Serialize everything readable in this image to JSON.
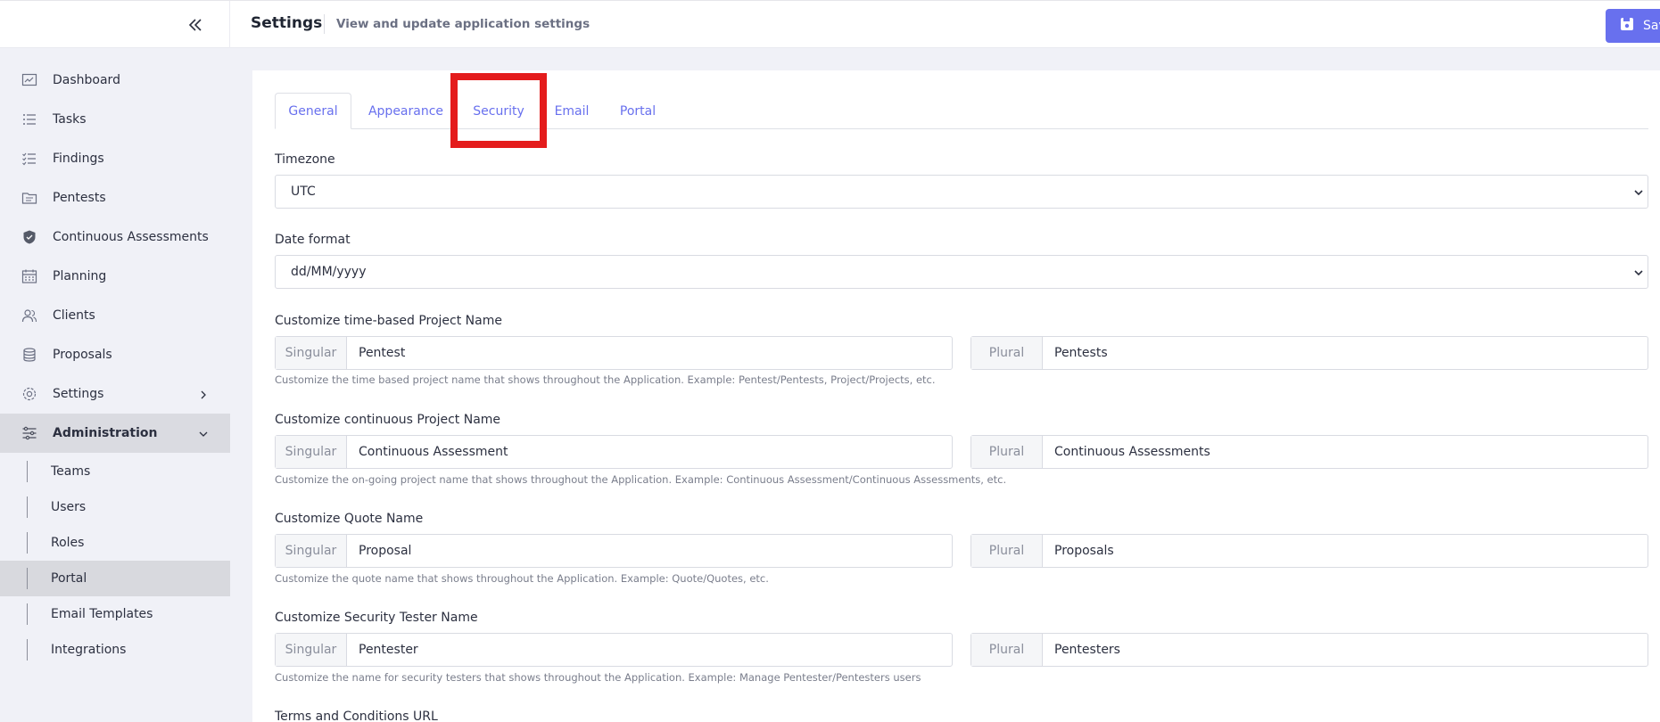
{
  "header": {
    "title": "Settings",
    "subtitle": "View and update application settings",
    "save_label": "Sav"
  },
  "sidebar": {
    "items": [
      {
        "label": "Dashboard",
        "icon": "chart-icon"
      },
      {
        "label": "Tasks",
        "icon": "list-icon"
      },
      {
        "label": "Findings",
        "icon": "checklist-icon"
      },
      {
        "label": "Pentests",
        "icon": "folder-icon"
      },
      {
        "label": "Continuous Assessments",
        "icon": "shield-icon"
      },
      {
        "label": "Planning",
        "icon": "calendar-icon"
      },
      {
        "label": "Clients",
        "icon": "users-icon"
      },
      {
        "label": "Proposals",
        "icon": "coins-icon"
      },
      {
        "label": "Settings",
        "icon": "gear-icon"
      },
      {
        "label": "Administration",
        "icon": "sliders-icon"
      }
    ],
    "admin_subitems": [
      {
        "label": "Teams"
      },
      {
        "label": "Users"
      },
      {
        "label": "Roles"
      },
      {
        "label": "Portal"
      },
      {
        "label": "Email Templates"
      },
      {
        "label": "Integrations"
      }
    ]
  },
  "tabs": [
    {
      "label": "General"
    },
    {
      "label": "Appearance"
    },
    {
      "label": "Security"
    },
    {
      "label": "Email"
    },
    {
      "label": "Portal"
    }
  ],
  "form": {
    "timezone": {
      "label": "Timezone",
      "value": "UTC"
    },
    "date_format": {
      "label": "Date format",
      "value": "dd/MM/yyyy"
    },
    "singular_addon": "Singular",
    "plural_addon": "Plural",
    "project_name": {
      "label": "Customize time-based Project Name",
      "singular": "Pentest",
      "plural": "Pentests",
      "help": "Customize the time based project name that shows throughout the Application. Example: Pentest/Pentests, Project/Projects, etc."
    },
    "continuous_name": {
      "label": "Customize continuous Project Name",
      "singular": "Continuous Assessment",
      "plural": "Continuous Assessments",
      "help": "Customize the on-going project name that shows throughout the Application. Example: Continuous Assessment/Continuous Assessments, etc."
    },
    "quote_name": {
      "label": "Customize Quote Name",
      "singular": "Proposal",
      "plural": "Proposals",
      "help": "Customize the quote name that shows throughout the Application. Example: Quote/Quotes, etc."
    },
    "tester_name": {
      "label": "Customize Security Tester Name",
      "singular": "Pentester",
      "plural": "Pentesters",
      "help": "Customize the name for security testers that shows throughout the Application. Example: Manage Pentester/Pentesters users"
    },
    "terms_url": {
      "label": "Terms and Conditions URL"
    }
  },
  "colors": {
    "accent": "#6870ee",
    "highlight": "#e41c1c",
    "sidebar_bg": "#f0f1f7"
  }
}
